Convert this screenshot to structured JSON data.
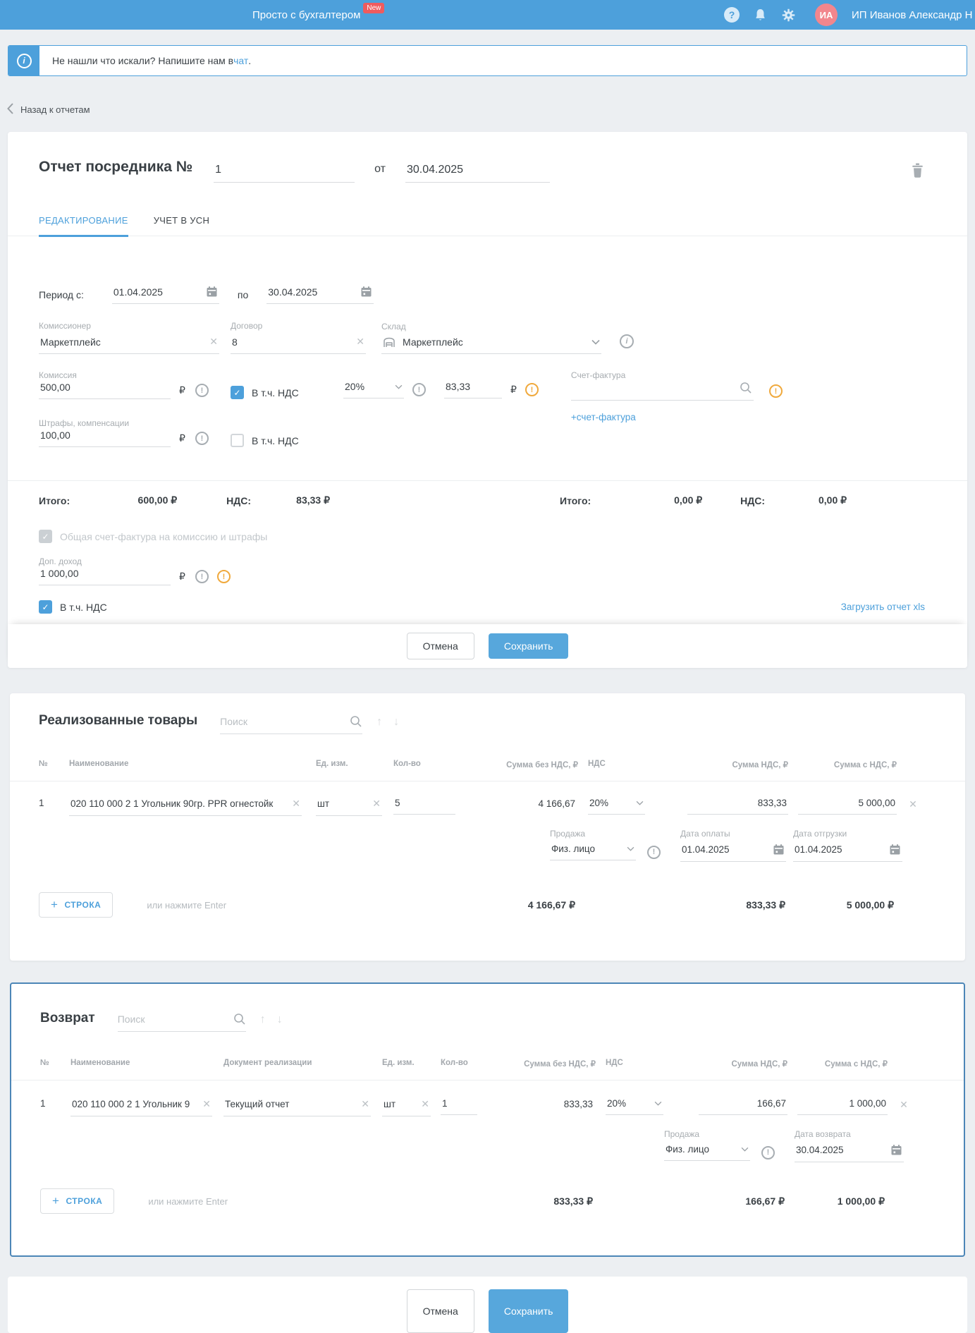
{
  "header": {
    "app_title": "Просто с бухгалтером",
    "badge": "New",
    "user_initials": "ИА",
    "user_name": "ИП Иванов Александр Н"
  },
  "banner": {
    "text_before": "Не нашли что искали? Напишите нам в ",
    "link": "чат",
    "text_after": "."
  },
  "back_link": "Назад к отчетам",
  "currency_symbol": "₽",
  "icons": {
    "help": "?",
    "info": "i",
    "exclamation": "!",
    "check": "✓",
    "clear": "✕",
    "arrow_up": "↑",
    "arrow_down": "↓",
    "plus": "+"
  },
  "colors": {
    "accent": "#4DA0DB",
    "save_button": "#57A7DC",
    "warning_orange": "#F0A93C",
    "badge_red": "#EF5B5E",
    "avatar_pink": "#F2868D",
    "returns_border": "#4C86B7"
  },
  "report": {
    "title": "Отчет посредника №",
    "number": "1",
    "from_label": "от",
    "date": "30.04.2025",
    "tabs": [
      {
        "label": "РЕДАКТИРОВАНИЕ"
      },
      {
        "label": "УЧЕТ В УСН"
      }
    ],
    "period": {
      "label": "Период с:",
      "from": "01.04.2025",
      "to_label": "по",
      "to": "30.04.2025"
    },
    "commissioner": {
      "label": "Комиссионер",
      "value": "Маркетплейс"
    },
    "contract": {
      "label": "Договор",
      "value": "8"
    },
    "warehouse": {
      "label": "Склад",
      "value": "Маркетплейс"
    },
    "commission": {
      "label": "Комиссия",
      "value": "500,00",
      "vat_checkbox": "В т.ч. НДС",
      "vat_rate": "20%",
      "vat_amount": "83,33"
    },
    "invoice": {
      "label": "Счет-фактура",
      "value": "",
      "add_link": "+счет-фактура"
    },
    "penalties": {
      "label": "Штрафы, компенсации",
      "value": "100,00",
      "vat_checkbox": "В т.ч. НДС"
    },
    "totals_left": {
      "label": "Итого:",
      "value": "600,00 ₽",
      "vat_label": "НДС:",
      "vat_value": "83,33 ₽"
    },
    "totals_right": {
      "label": "Итого:",
      "value": "0,00 ₽",
      "vat_label": "НДС:",
      "vat_value": "0,00 ₽"
    },
    "common_invoice_checkbox": "Общая счет-фактура на комиссию и штрафы",
    "extra_income": {
      "label": "Доп. доход",
      "value": "1 000,00"
    },
    "extra_income_vat_checkbox": "В т.ч. НДС",
    "upload_link": "Загрузить отчет xls",
    "cancel_button": "Отмена",
    "save_button": "Сохранить"
  },
  "sold_goods": {
    "title": "Реализованные товары",
    "search_placeholder": "Поиск",
    "columns": [
      "№",
      "Наименование",
      "Ед. изм.",
      "Кол-во",
      "Сумма без НДС, ₽",
      "НДС",
      "Сумма НДС, ₽",
      "Сумма с НДС, ₽"
    ],
    "rows": [
      {
        "num": "1",
        "name": "020 110 000 2 1 Угольник 90гр. PPR огнестойк",
        "unit": "шт",
        "qty": "5",
        "sum_no_vat": "4 166,67",
        "vat_rate": "20%",
        "vat_sum": "833,33",
        "sum_with_vat": "5 000,00",
        "sale_label": "Продажа",
        "sale_type": "Физ. лицо",
        "pay_date_label": "Дата оплаты",
        "pay_date": "01.04.2025",
        "ship_date_label": "Дата отгрузки",
        "ship_date": "01.04.2025"
      }
    ],
    "add_row_button": "СТРОКА",
    "add_row_hint": "или нажмите Enter",
    "totals": {
      "sum_no_vat": "4 166,67 ₽",
      "vat_sum": "833,33 ₽",
      "sum_with_vat": "5 000,00 ₽"
    }
  },
  "returns": {
    "title": "Возврат",
    "search_placeholder": "Поиск",
    "columns": [
      "№",
      "Наименование",
      "Документ реализации",
      "Ед. изм.",
      "Кол-во",
      "Сумма без НДС, ₽",
      "НДС",
      "Сумма НДС, ₽",
      "Сумма с НДС, ₽"
    ],
    "rows": [
      {
        "num": "1",
        "name": "020 110 000 2 1 Угольник 9",
        "doc": "Текущий отчет",
        "unit": "шт",
        "qty": "1",
        "sum_no_vat": "833,33",
        "vat_rate": "20%",
        "vat_sum": "166,67",
        "sum_with_vat": "1 000,00",
        "sale_label": "Продажа",
        "sale_type": "Физ. лицо",
        "return_date_label": "Дата возврата",
        "return_date": "30.04.2025"
      }
    ],
    "add_row_button": "СТРОКА",
    "add_row_hint": "или нажмите Enter",
    "totals": {
      "sum_no_vat": "833,33 ₽",
      "vat_sum": "166,67 ₽",
      "sum_with_vat": "1 000,00 ₽"
    }
  },
  "footer": {
    "cancel_button": "Отмена",
    "save_button": "Сохранить"
  }
}
